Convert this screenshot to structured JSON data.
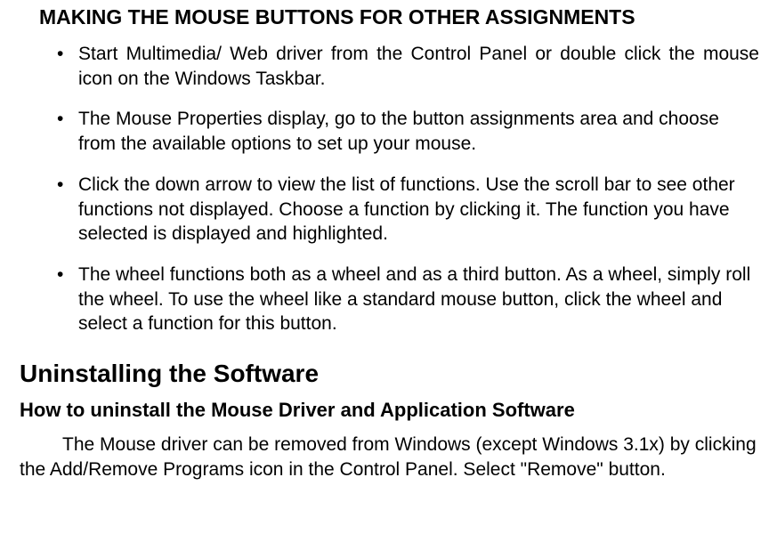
{
  "section1": {
    "heading": "MAKING THE MOUSE BUTTONS FOR OTHER ASSIGNMENTS",
    "bullets": [
      "Start Multimedia/ Web driver from the Control Panel or double click the mouse icon on the Windows Taskbar.",
      "The Mouse Properties display, go to the button assignments area and choose from the available options to set up your mouse.",
      "Click the down arrow to view the list of functions. Use the scroll bar to see other functions not displayed. Choose a function by clicking it. The function you have selected is displayed and highlighted.",
      "The wheel functions both as a wheel and as a third button. As a wheel, simply roll the wheel. To use the wheel like a standard mouse button, click the wheel and select a function for this button."
    ]
  },
  "section2": {
    "heading": "Uninstalling the Software",
    "subheading": "How to uninstall the Mouse Driver and Application Software",
    "paragraph": "The Mouse driver can be removed from Windows (except Windows 3.1x) by clicking the Add/Remove Programs icon in the Control Panel. Select \"Remove\" button."
  }
}
